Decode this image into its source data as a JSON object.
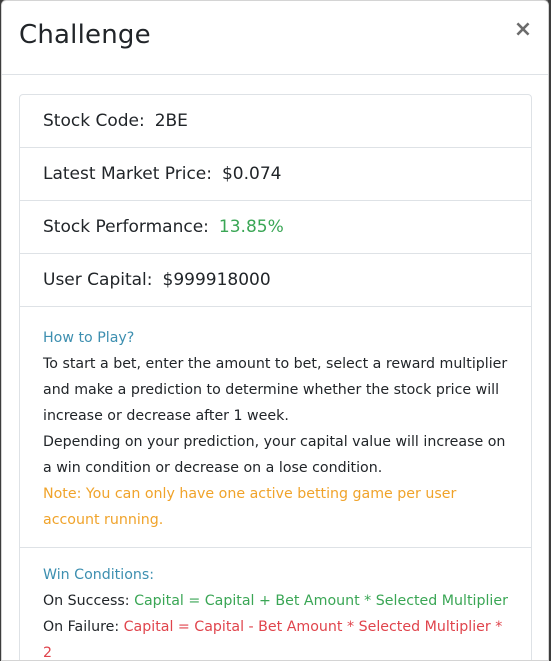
{
  "modal": {
    "title": "Challenge",
    "close_label": "×"
  },
  "details": {
    "stock_code_label": "Stock Code:",
    "stock_code_value": "2BE",
    "market_price_label": "Latest Market Price:",
    "market_price_value": "$0.074",
    "performance_label": "Stock Performance:",
    "performance_value": "13.85%",
    "capital_label": "User Capital:",
    "capital_value": "$999918000"
  },
  "how_to_play": {
    "heading": "How to Play?",
    "paragraph_1": "To start a bet, enter the amount to bet, select a reward multiplier and make a prediction to determine whether the stock price will increase or decrease after 1 week.",
    "paragraph_2": "Depending on your prediction, your capital value will increase on a win condition or decrease on a lose condition.",
    "note": "Note: You can only have one active betting game per user account running."
  },
  "win_conditions": {
    "heading": "Win Conditions:",
    "success_label": "On Success:",
    "success_formula": "Capital = Capital + Bet Amount * Selected Multiplier",
    "failure_label": "On Failure:",
    "failure_formula": "Capital = Capital - Bet Amount * Selected Multiplier * 2"
  },
  "colors": {
    "positive": "#3aa655",
    "negative": "#e0444c",
    "heading": "#3d8fb0",
    "note": "#f0a32a"
  }
}
